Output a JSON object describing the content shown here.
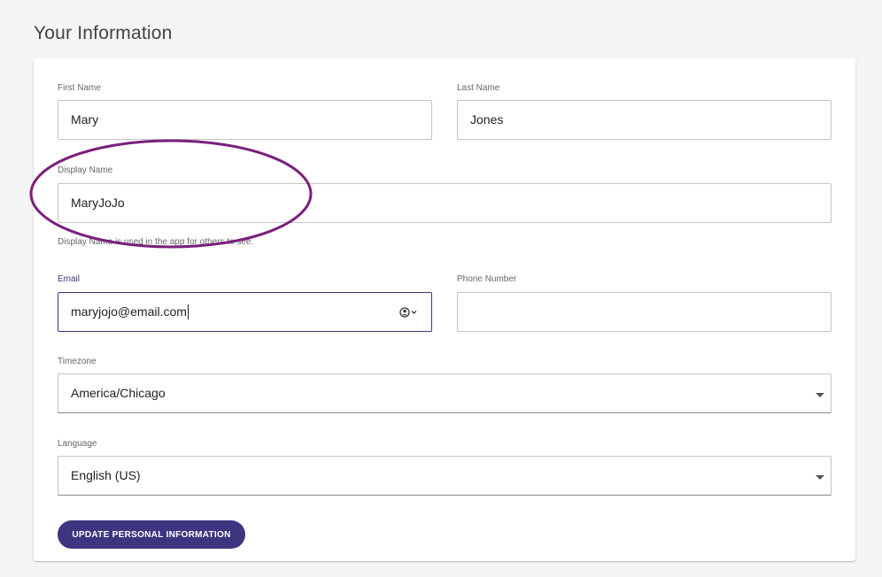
{
  "page": {
    "title": "Your Information"
  },
  "form": {
    "first_name": {
      "label": "First Name",
      "value": "Mary"
    },
    "last_name": {
      "label": "Last Name",
      "value": "Jones"
    },
    "display_name": {
      "label": "Display Name",
      "value": "MaryJoJo",
      "helper": "Display Name is used in the app for others to see."
    },
    "email": {
      "label": "Email",
      "value": "maryjojo@email.com",
      "autofill_icon": "contact-autofill-icon"
    },
    "phone_number": {
      "label": "Phone Number",
      "value": ""
    },
    "timezone": {
      "label": "Timezone",
      "value": "America/Chicago"
    },
    "language": {
      "label": "Language",
      "value": "English (US)"
    },
    "submit_label": "UPDATE PERSONAL INFORMATION"
  },
  "colors": {
    "accent": "#3d3580",
    "annotation": "#7b1f7d",
    "background": "#f5f5f5",
    "card": "#ffffff"
  }
}
